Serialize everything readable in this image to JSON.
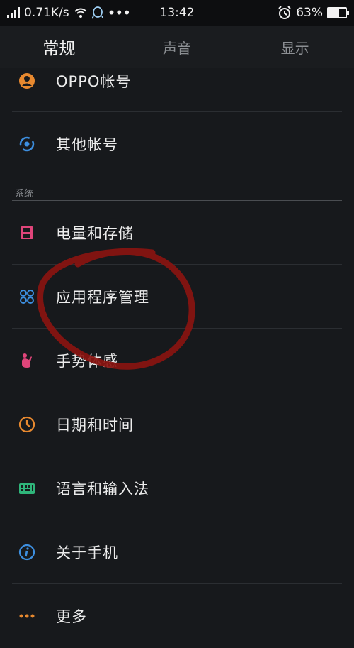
{
  "status_bar": {
    "network_speed": "0.71K/s",
    "time": "13:42",
    "battery": "63%",
    "battery_level": 0.63,
    "icons": [
      "signal-icon",
      "wifi-icon",
      "qq-icon",
      "more-dots-icon",
      "alarm-icon",
      "battery-icon"
    ]
  },
  "tabs": [
    {
      "label": "常规",
      "active": true
    },
    {
      "label": "声音",
      "active": false
    },
    {
      "label": "显示",
      "active": false
    }
  ],
  "accounts": [
    {
      "label": "OPPO帐号",
      "icon": "oppo-account-icon",
      "color": "#e8892f"
    },
    {
      "label": "其他帐号",
      "icon": "sync-account-icon",
      "color": "#3d8fe0"
    }
  ],
  "system_section": {
    "header": "系统",
    "items": [
      {
        "label": "电量和存储",
        "icon": "storage-icon",
        "color": "#e0457a"
      },
      {
        "label": "应用程序管理",
        "icon": "apps-icon",
        "color": "#3d8fe0"
      },
      {
        "label": "手势体感",
        "icon": "gesture-icon",
        "color": "#e0457a"
      },
      {
        "label": "日期和时间",
        "icon": "clock-icon",
        "color": "#e8892f"
      },
      {
        "label": "语言和输入法",
        "icon": "keyboard-icon",
        "color": "#2fb57a"
      },
      {
        "label": "关于手机",
        "icon": "info-icon",
        "color": "#3d8fe0"
      },
      {
        "label": "更多",
        "icon": "more-icon",
        "color": "#e8892f"
      }
    ]
  },
  "annotation": {
    "color": "#8a1410",
    "description": "hand-drawn red circle"
  }
}
